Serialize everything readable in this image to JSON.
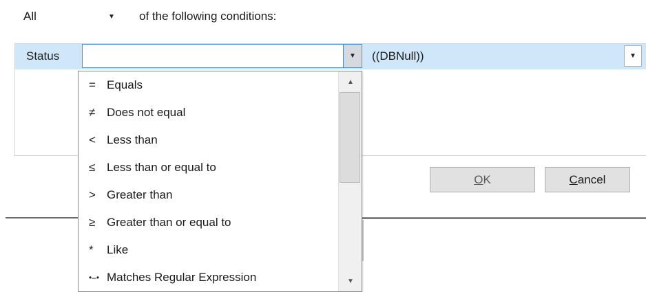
{
  "top": {
    "combine_value": "All",
    "combine_arrow": "▼",
    "conditions_text": "of the following conditions:"
  },
  "row": {
    "field_label": "Status",
    "operator_value": "",
    "operator_arrow": "▼",
    "value_text": "((DBNull))",
    "value_arrow": "▼"
  },
  "buttons": {
    "ok_mnemonic": "O",
    "ok_rest": "K",
    "cancel_mnemonic": "C",
    "cancel_rest": "ancel"
  },
  "operators": [
    {
      "symbol": "=",
      "label": "Equals",
      "icon": "equals-icon"
    },
    {
      "symbol": "≠",
      "label": "Does not equal",
      "icon": "not-equal-icon"
    },
    {
      "symbol": "<",
      "label": "Less than",
      "icon": "less-than-icon"
    },
    {
      "symbol": "≤",
      "label": "Less than or equal to",
      "icon": "less-equal-icon"
    },
    {
      "symbol": ">",
      "label": "Greater than",
      "icon": "greater-than-icon"
    },
    {
      "symbol": "≥",
      "label": "Greater than or equal to",
      "icon": "greater-equal-icon"
    },
    {
      "symbol": "*",
      "label": "Like",
      "icon": "like-icon"
    },
    {
      "symbol": "•–•",
      "label": "Matches Regular Expression",
      "icon": "regex-icon"
    }
  ],
  "scrollbar": {
    "up_arrow": "▲",
    "down_arrow": "▼"
  },
  "colors": {
    "row_highlight": "#cfe7f9",
    "focus_border": "#4a90d9"
  }
}
